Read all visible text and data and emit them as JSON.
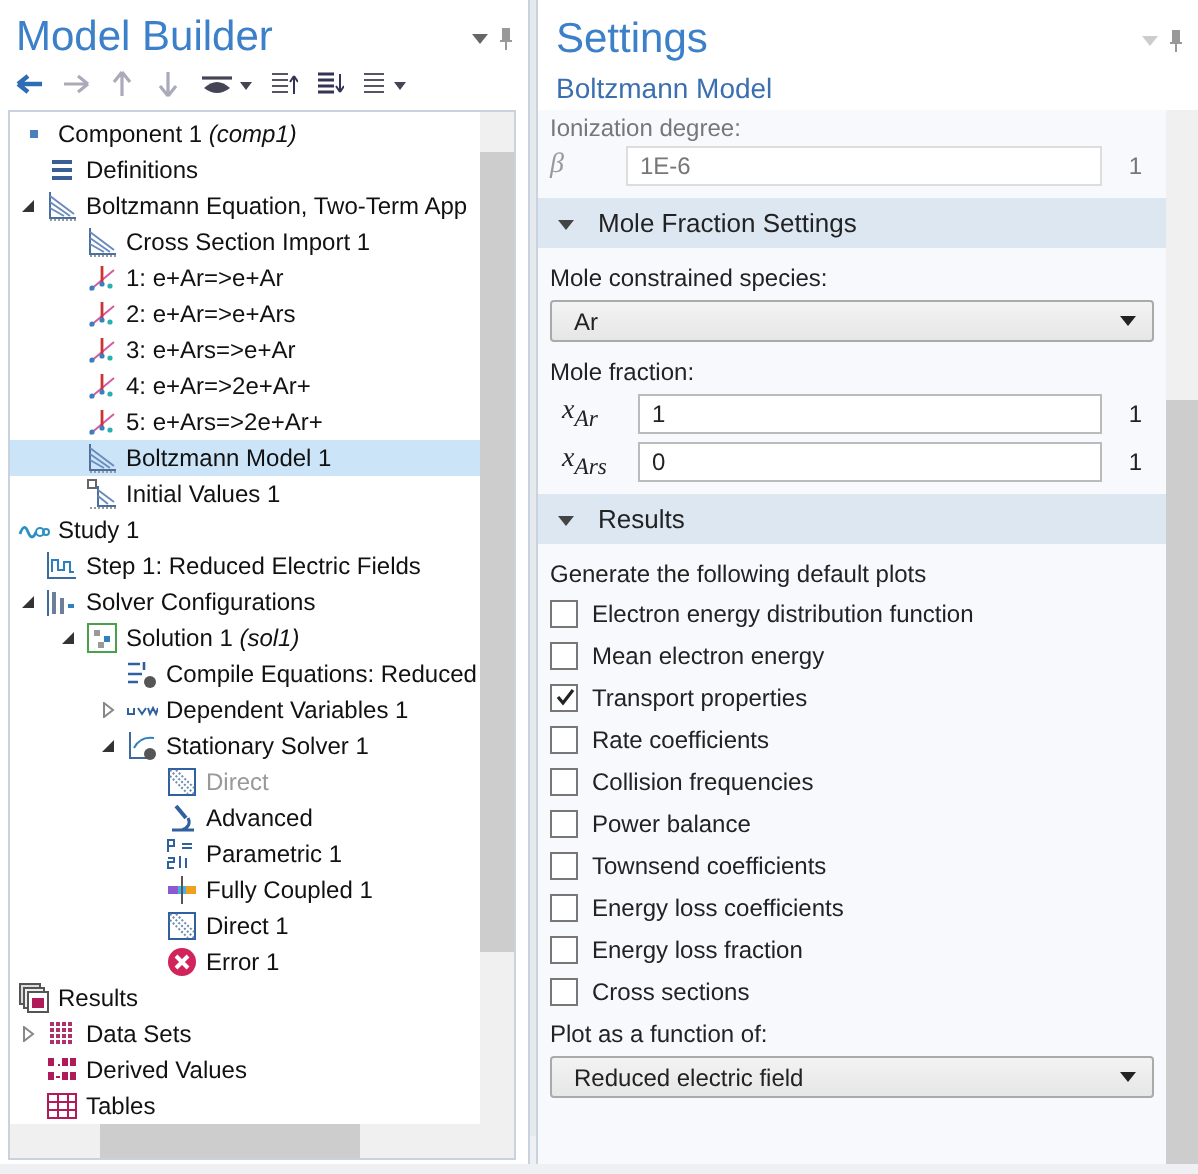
{
  "model_builder": {
    "title": "Model Builder",
    "tree": [
      {
        "label": "Component 1 *(comp1)*",
        "kind": "component",
        "selected": false,
        "disabled": false,
        "children": [
          {
            "label": "Definitions",
            "kind": "definitions",
            "selected": false,
            "disabled": false
          },
          {
            "label": "Boltzmann Equation, Two-Term App",
            "kind": "physics",
            "selected": false,
            "disabled": false,
            "expanded": true,
            "children": [
              {
                "label": "Cross Section Import 1",
                "kind": "physics",
                "selected": false,
                "disabled": false
              },
              {
                "label": "1: e+Ar=>e+Ar",
                "kind": "reaction",
                "selected": false,
                "disabled": false
              },
              {
                "label": "2: e+Ar=>e+Ars",
                "kind": "reaction",
                "selected": false,
                "disabled": false
              },
              {
                "label": "3: e+Ars=>e+Ar",
                "kind": "reaction",
                "selected": false,
                "disabled": false
              },
              {
                "label": "4: e+Ar=>2e+Ar+",
                "kind": "reaction",
                "selected": false,
                "disabled": false
              },
              {
                "label": "5: e+Ars=>2e+Ar+",
                "kind": "reaction",
                "selected": false,
                "disabled": false
              },
              {
                "label": "Boltzmann Model 1",
                "kind": "physics",
                "selected": true,
                "disabled": false
              },
              {
                "label": "Initial Values 1",
                "kind": "initial",
                "selected": false,
                "disabled": false
              }
            ]
          }
        ]
      },
      {
        "label": "Study 1",
        "kind": "study",
        "selected": false,
        "disabled": false,
        "children": [
          {
            "label": "Step 1: Reduced Electric Fields",
            "kind": "step",
            "selected": false,
            "disabled": false
          },
          {
            "label": "Solver Configurations",
            "kind": "solvers",
            "selected": false,
            "disabled": false,
            "expanded": true,
            "children": [
              {
                "label": "Solution 1 *(sol1)*",
                "kind": "solution",
                "selected": false,
                "disabled": false,
                "expanded": true,
                "children": [
                  {
                    "label": "Compile Equations: Reduced",
                    "kind": "compile",
                    "selected": false,
                    "disabled": false
                  },
                  {
                    "label": "Dependent Variables 1",
                    "kind": "dependent",
                    "selected": false,
                    "disabled": false,
                    "expanded": false
                  },
                  {
                    "label": "Stationary Solver 1",
                    "kind": "stationary",
                    "selected": false,
                    "disabled": false,
                    "expanded": true,
                    "children": [
                      {
                        "label": "Direct",
                        "kind": "direct",
                        "selected": false,
                        "disabled": true
                      },
                      {
                        "label": "Advanced",
                        "kind": "advanced",
                        "selected": false,
                        "disabled": false
                      },
                      {
                        "label": "Parametric 1",
                        "kind": "parametric",
                        "selected": false,
                        "disabled": false
                      },
                      {
                        "label": "Fully Coupled 1",
                        "kind": "coupled",
                        "selected": false,
                        "disabled": false
                      },
                      {
                        "label": "Direct 1",
                        "kind": "direct",
                        "selected": false,
                        "disabled": false
                      },
                      {
                        "label": "Error 1",
                        "kind": "error",
                        "selected": false,
                        "disabled": false
                      }
                    ]
                  }
                ]
              }
            ]
          }
        ]
      },
      {
        "label": "Results",
        "kind": "results",
        "selected": false,
        "disabled": false,
        "children": [
          {
            "label": "Data Sets",
            "kind": "datasets",
            "selected": false,
            "disabled": false,
            "expanded": false
          },
          {
            "label": "Derived Values",
            "kind": "derived",
            "selected": false,
            "disabled": false
          },
          {
            "label": "Tables",
            "kind": "tables",
            "selected": false,
            "disabled": false
          }
        ]
      }
    ]
  },
  "settings": {
    "title": "Settings",
    "subtitle": "Boltzmann Model",
    "ionization": {
      "label": "Ionization degree:",
      "symbol": "β",
      "value": "1E-6",
      "unit": "1",
      "disabled": true
    },
    "mole_fraction_section": {
      "title": "Mole Fraction Settings",
      "expanded": true,
      "species_label": "Mole constrained species:",
      "species_value": "Ar",
      "fraction_label": "Mole fraction:",
      "fractions": [
        {
          "symbol": "x$_{Ar}$",
          "value": "1",
          "unit": "1"
        },
        {
          "symbol": "x$_{Ars}$",
          "value": "0",
          "unit": "1"
        }
      ]
    },
    "results_section": {
      "title": "Results",
      "expanded": true,
      "plots_label": "Generate the following default plots",
      "plots": [
        {
          "label": "Electron energy distribution function",
          "checked": false
        },
        {
          "label": "Mean electron energy",
          "checked": false
        },
        {
          "label": "Transport properties",
          "checked": true
        },
        {
          "label": "Rate coefficients",
          "checked": false
        },
        {
          "label": "Collision frequencies",
          "checked": false
        },
        {
          "label": "Power balance",
          "checked": false
        },
        {
          "label": "Townsend coefficients",
          "checked": false
        },
        {
          "label": "Energy loss coefficients",
          "checked": false
        },
        {
          "label": "Energy loss fraction",
          "checked": false
        },
        {
          "label": "Cross sections",
          "checked": false
        }
      ],
      "function_label": "Plot as a function of:",
      "function_value": "Reduced electric field"
    }
  }
}
